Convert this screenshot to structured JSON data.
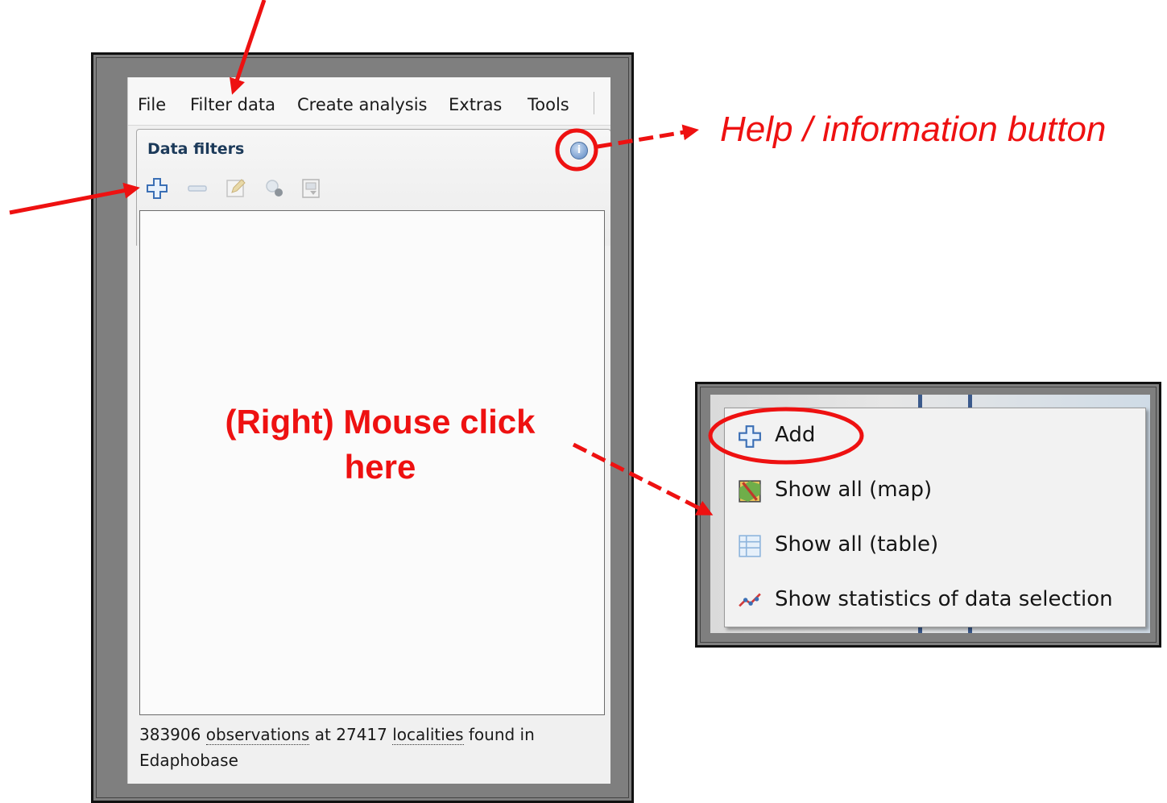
{
  "menu": {
    "items": [
      "File",
      "Filter data",
      "Create analysis",
      "Extras",
      "Tools"
    ]
  },
  "panel": {
    "tab_title": "Data filters",
    "help_icon": "info-icon",
    "toolbar_icons": [
      "add-icon",
      "remove-icon",
      "edit-icon",
      "filter-settings-icon",
      "export-icon"
    ]
  },
  "status": {
    "count_observations": "383906",
    "word_observations": "observations",
    "word_at": "at",
    "count_localities": "27417",
    "word_localities": "localities",
    "tail": "found in",
    "source": "Edaphobase"
  },
  "context_menu": {
    "items": [
      {
        "label": "Add",
        "icon": "add-icon"
      },
      {
        "label": "Show all (map)",
        "icon": "map-icon"
      },
      {
        "label": "Show all (table)",
        "icon": "table-icon"
      },
      {
        "label": "Show statistics of data selection",
        "icon": "statistics-icon"
      }
    ]
  },
  "annotations": {
    "help_label": "Help / information button",
    "right_click_line1": "(Right) Mouse click",
    "right_click_line2": "here",
    "color": "#ee1111"
  }
}
